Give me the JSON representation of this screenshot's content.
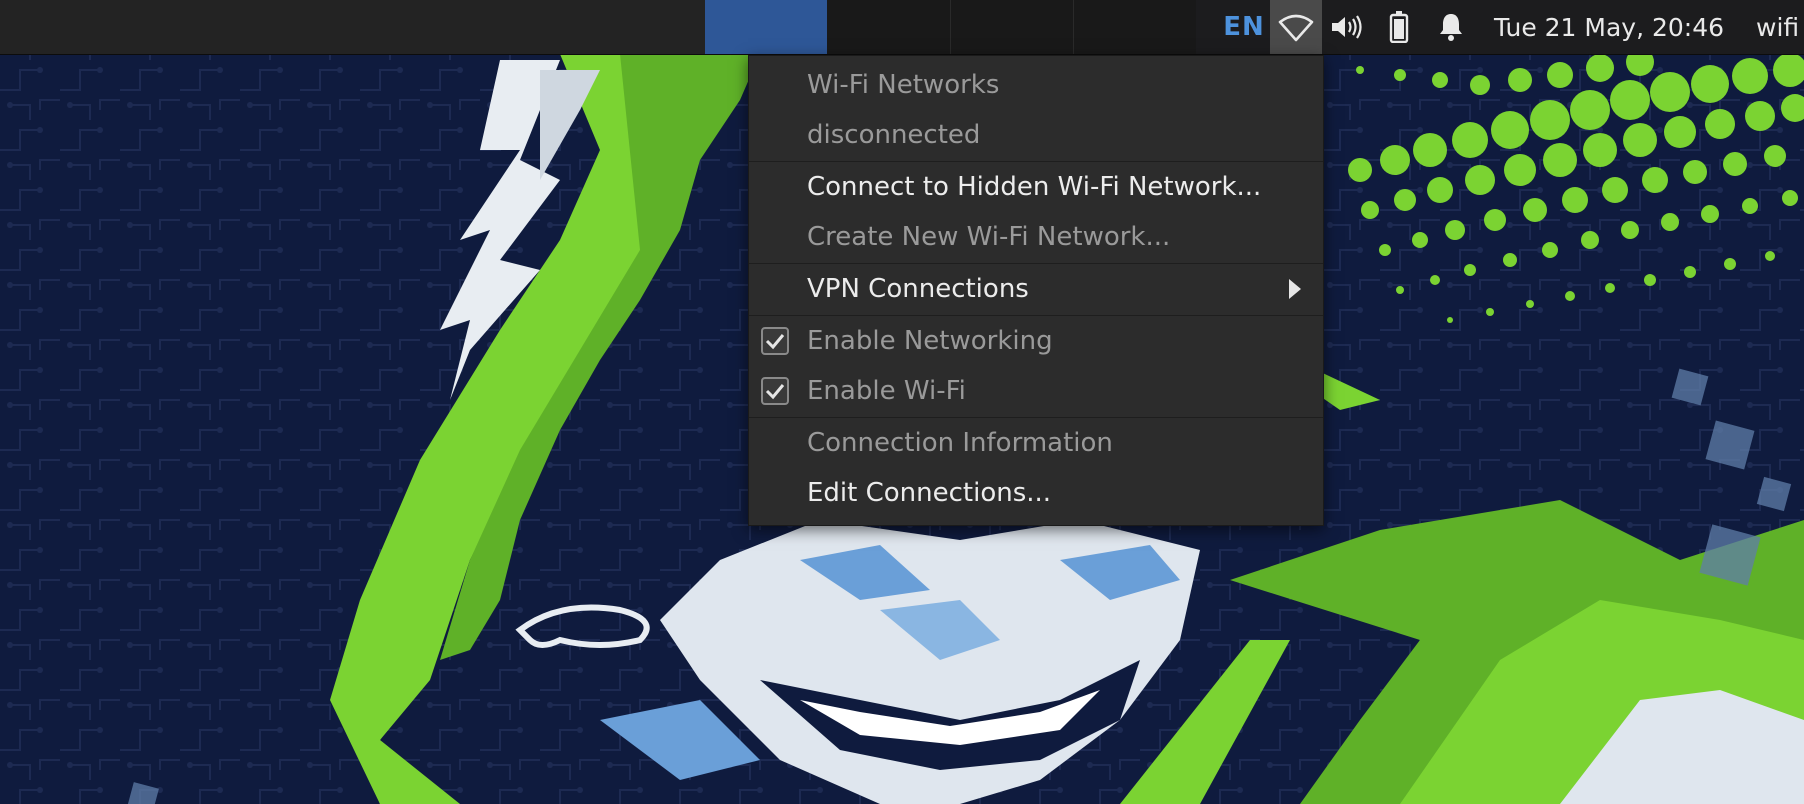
{
  "panel": {
    "language": "EN",
    "clock": "Tue 21 May, 20:46",
    "network_label": "wifi"
  },
  "icons": {
    "wifi": "wifi-icon",
    "volume": "volume-icon",
    "battery": "battery-icon",
    "bell": "bell-icon",
    "checkbox": "checkmark-icon",
    "submenu": "chevron-right-icon"
  },
  "menu": {
    "header": "Wi-Fi Networks",
    "status": "disconnected",
    "connect_hidden": "Connect to Hidden Wi-Fi Network...",
    "create_new": "Create New Wi-Fi Network...",
    "vpn": "VPN Connections",
    "enable_networking": "Enable Networking",
    "enable_networking_checked": true,
    "enable_wifi": "Enable Wi-Fi",
    "enable_wifi_checked": true,
    "connection_info": "Connection Information",
    "edit_connections": "Edit Connections..."
  },
  "colors": {
    "panel_bg": "#1c1c1e",
    "active_task": "#2e5797",
    "menu_bg": "#2c2c2c",
    "language_accent": "#4d92dd",
    "wallpaper_bg": "#0f1b3e",
    "wallpaper_green": "#7bd332"
  }
}
